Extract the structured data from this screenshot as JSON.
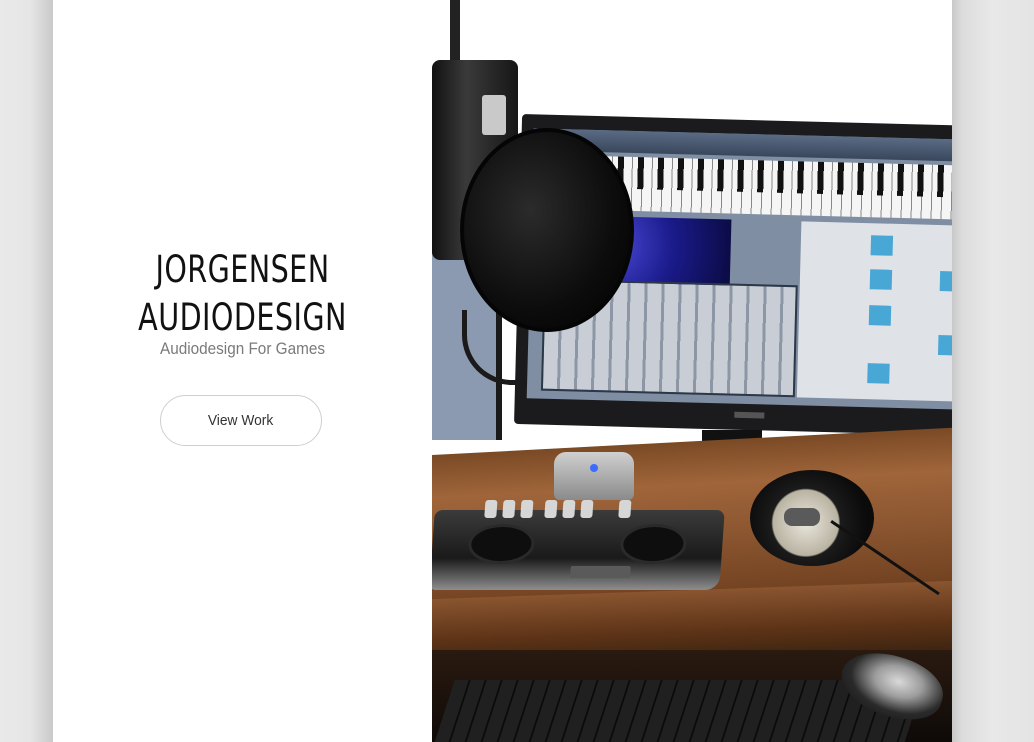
{
  "brand": {
    "title_line1": "JORGENSEN",
    "title_line2": "AUDIODESIGN",
    "subtitle": "Audiodesign For Games"
  },
  "cta": {
    "label": "View Work"
  },
  "hero": {
    "alt": "photo-recording-studio",
    "screen_colors": {
      "keys": "#f5f5f5",
      "synth_accent": "#49a7d6",
      "space": "#1a1a8a"
    }
  }
}
